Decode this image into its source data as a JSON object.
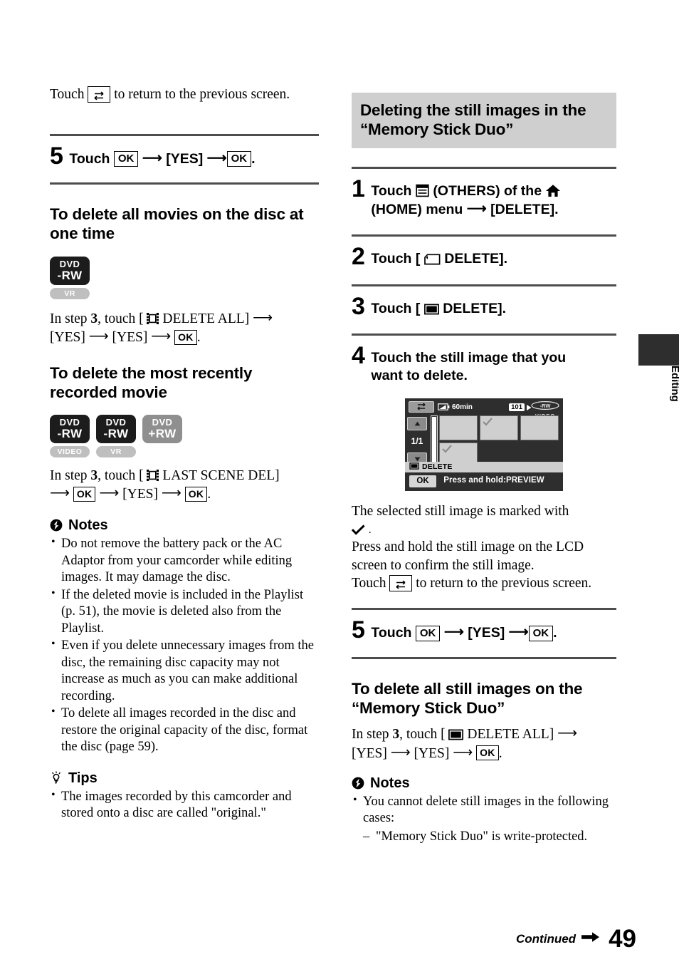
{
  "page": {
    "number": "49",
    "continued_label": "Continued",
    "side_tab_label": "Editing"
  },
  "left_column": {
    "intro": {
      "touch_word": "Touch",
      "rest": "to return to the previous screen.",
      "icon": "return-icon"
    },
    "step5": {
      "number": "5",
      "touch": "Touch",
      "ok1": "OK",
      "yes": "[YES]",
      "ok2": "OK",
      "period": "."
    },
    "section_all_movies": {
      "heading": "To delete all movies on the disc at one time",
      "badges": [
        {
          "line1": "DVD",
          "line2": "-RW",
          "style": "dark",
          "format": "VR"
        }
      ],
      "instruction": {
        "prefix": "In step",
        "stepnum": "3",
        "mid": ", touch [",
        "icon": "movie-film-icon",
        "label": "DELETE ALL]",
        "yes1": "[YES]",
        "yes2": "[YES]",
        "ok": "OK",
        "period": "."
      }
    },
    "section_recent_movie": {
      "heading": "To delete the most recently recorded movie",
      "badges": [
        {
          "line1": "DVD",
          "line2": "-RW",
          "style": "dark",
          "format": "VIDEO"
        },
        {
          "line1": "DVD",
          "line2": "-RW",
          "style": "dark",
          "format": "VR"
        },
        {
          "line1": "DVD",
          "line2": "+RW",
          "style": "grey",
          "format": ""
        }
      ],
      "instruction": {
        "prefix": "In step",
        "stepnum": "3",
        "mid": ", touch  [",
        "icon": "movie-film-icon",
        "label": "LAST SCENE DEL]",
        "ok1": "OK",
        "yes": "[YES]",
        "ok2": "OK",
        "period": "."
      }
    },
    "notes": {
      "title": "Notes",
      "icon": "notes-icon",
      "items": [
        "Do not remove the battery pack or the AC Adaptor from your camcorder while editing images. It may damage the disc.",
        "If the deleted movie is included in the Playlist (p. 51), the movie is deleted also from the Playlist.",
        "Even if you delete unnecessary images from the disc, the remaining disc capacity may not increase as much as you can make additional recording.",
        "To delete all images recorded in the disc and restore the original capacity of the disc, format the disc (page 59)."
      ]
    },
    "tips": {
      "title": "Tips",
      "icon": "tips-bulb-icon",
      "items": [
        "The images recorded by this camcorder and stored onto a disc are called \"original.\""
      ]
    }
  },
  "right_column": {
    "banner_heading": "Deleting the still images in the “Memory Stick Duo”",
    "step1": {
      "number": "1",
      "line1_a": "Touch",
      "icon_others": "others-grid-icon",
      "line1_b": "(OTHERS) of the",
      "icon_home": "home-icon",
      "line2": "(HOME) menu",
      "line2_b": "[DELETE]."
    },
    "step2": {
      "number": "2",
      "touch": "Touch [",
      "icon": "memory-stick-icon",
      "label": "DELETE]."
    },
    "step3": {
      "number": "3",
      "touch": "Touch [",
      "icon": "still-image-icon",
      "label": "DELETE]."
    },
    "step4": {
      "number": "4",
      "text": "Touch the still image that you want to delete."
    },
    "lcd": {
      "back_icon": "return-icon",
      "battery_icon": "battery-icon",
      "battery_text": "60min",
      "folder_number": "101",
      "folder_arrow_icon": "play-triangle-icon",
      "disc_icon": "-RW",
      "disc_format": "VIDEO",
      "up_icon": "up-triangle-icon",
      "down_icon": "down-triangle-icon",
      "page_indicator": "1/1",
      "scrollbar_icon": "scrollbar",
      "check_icon": "check-icon",
      "strip_icon": "still-image-icon",
      "strip_label": "DELETE",
      "ok_label": "OK",
      "hint_label": "Press and hold:PREVIEW",
      "thumbnails": [
        {
          "checked": false
        },
        {
          "checked": true
        },
        {
          "checked": false
        },
        {
          "checked": true
        }
      ]
    },
    "after_lcd": {
      "line1": "The selected still image is marked with",
      "check_icon": "check-icon",
      "period": ".",
      "line2": "Press and hold the still image on the LCD screen to confirm the still image.",
      "line3_a": "Touch",
      "return_icon": "return-icon",
      "line3_b": "to return to the previous screen."
    },
    "step5": {
      "number": "5",
      "touch": "Touch",
      "ok1": "OK",
      "yes": "[YES]",
      "ok2": "OK",
      "period": "."
    },
    "section_all_stills": {
      "heading": "To delete all still images on the “Memory Stick Duo”",
      "instruction": {
        "prefix": "In step",
        "stepnum": "3",
        "mid": ", touch [",
        "icon": "still-image-icon",
        "label": "DELETE ALL]",
        "yes1": "[YES]",
        "yes2": "[YES]",
        "ok": "OK",
        "period": "."
      }
    },
    "notes": {
      "title": "Notes",
      "icon": "notes-icon",
      "items": [
        "You cannot delete still images in the following cases:"
      ],
      "subitems": [
        "\"Memory Stick Duo\" is write-protected."
      ]
    }
  }
}
